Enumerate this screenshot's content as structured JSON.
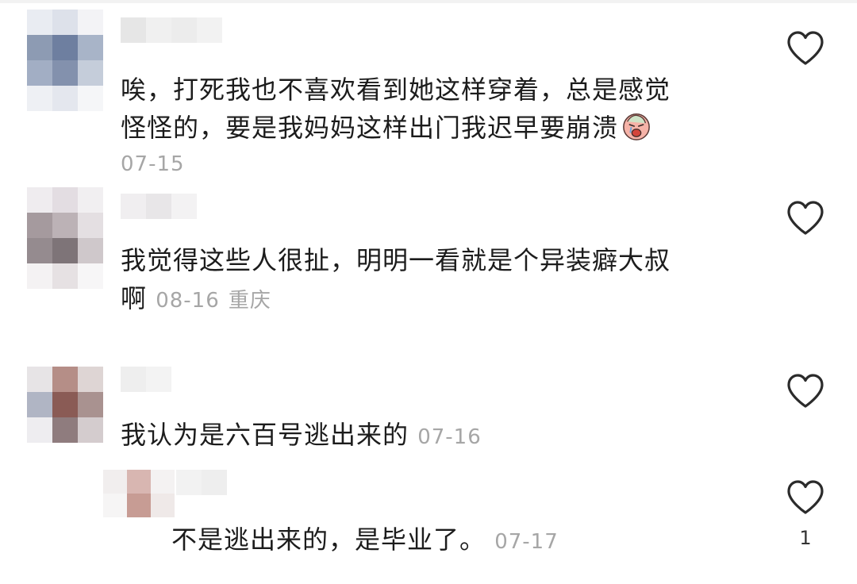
{
  "comments": [
    {
      "text_lines": [
        "唉，打死我也不喜欢看到她这样穿着，总是感觉",
        "怪怪的，要是我妈妈这样出门我迟早要崩溃"
      ],
      "emoji": "crying-face-emoji",
      "date": "07-15",
      "location": "",
      "likes": ""
    },
    {
      "text_lines": [
        "我觉得这些人很扯，明明一看就是个异装癖大叔",
        "啊"
      ],
      "date": "08-16",
      "location": "重庆",
      "likes": ""
    },
    {
      "text": "我认为是六百号逃出来的",
      "date": "07-16",
      "likes": ""
    }
  ],
  "reply": {
    "text": "不是逃出来的，是毕业了。",
    "date": "07-17",
    "likes": "1"
  },
  "icons": {
    "like": "heart-outline-icon"
  },
  "colors": {
    "text": "#1c1c1c",
    "meta": "#a6a6a6",
    "heart_stroke": "#2b2b2b"
  }
}
